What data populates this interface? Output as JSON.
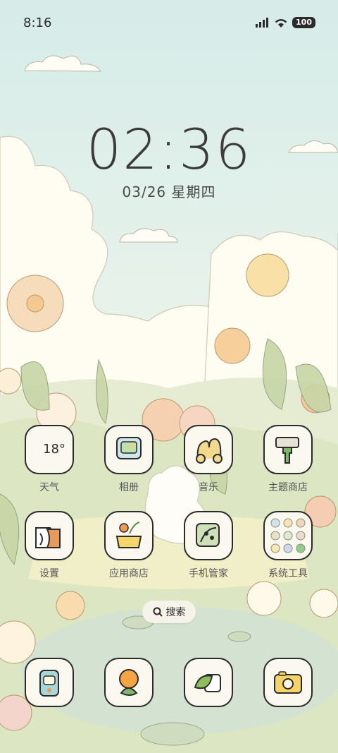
{
  "status_bar": {
    "time": "8:16",
    "battery": "100"
  },
  "lock": {
    "clock": "02:36",
    "date": "03/26 星期四"
  },
  "apps_row1": [
    {
      "label": "天气",
      "temp": "18°"
    },
    {
      "label": "相册"
    },
    {
      "label": "音乐"
    },
    {
      "label": "主题商店"
    }
  ],
  "apps_row2": [
    {
      "label": "设置"
    },
    {
      "label": "应用商店"
    },
    {
      "label": "手机管家"
    },
    {
      "label": "系统工具"
    }
  ],
  "search": {
    "label": "搜索"
  },
  "dock": [
    {
      "icon": "walkie-talkie-icon"
    },
    {
      "icon": "flower-icon"
    },
    {
      "icon": "leaf-message-icon"
    },
    {
      "icon": "camera-icon"
    }
  ]
}
